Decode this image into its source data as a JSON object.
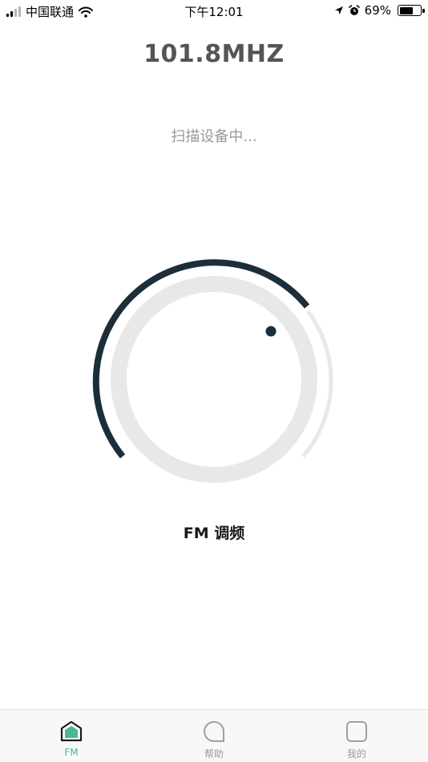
{
  "status_bar": {
    "carrier": "中国联通",
    "time": "下午12:01",
    "battery": "69%",
    "battery_level": 0.69,
    "icons": [
      "signal-icon",
      "wifi-icon",
      "location-icon",
      "alarm-icon",
      "battery-icon"
    ]
  },
  "main": {
    "frequency": "101.8MHZ",
    "scan_status": "扫描设备中...",
    "dial_label": "FM 调频"
  },
  "tab_bar": {
    "tabs": [
      {
        "label": "FM",
        "icon": "home-icon",
        "active": true
      },
      {
        "label": "帮助",
        "icon": "help-icon",
        "active": false
      },
      {
        "label": "我的",
        "icon": "profile-icon",
        "active": false
      }
    ]
  },
  "colors": {
    "accent": "#4bb98d",
    "dial_dark": "#1b2e3a",
    "dial_track": "#e8e8e8",
    "frequency_text": "#555555",
    "muted_text": "#9a9a9a"
  }
}
